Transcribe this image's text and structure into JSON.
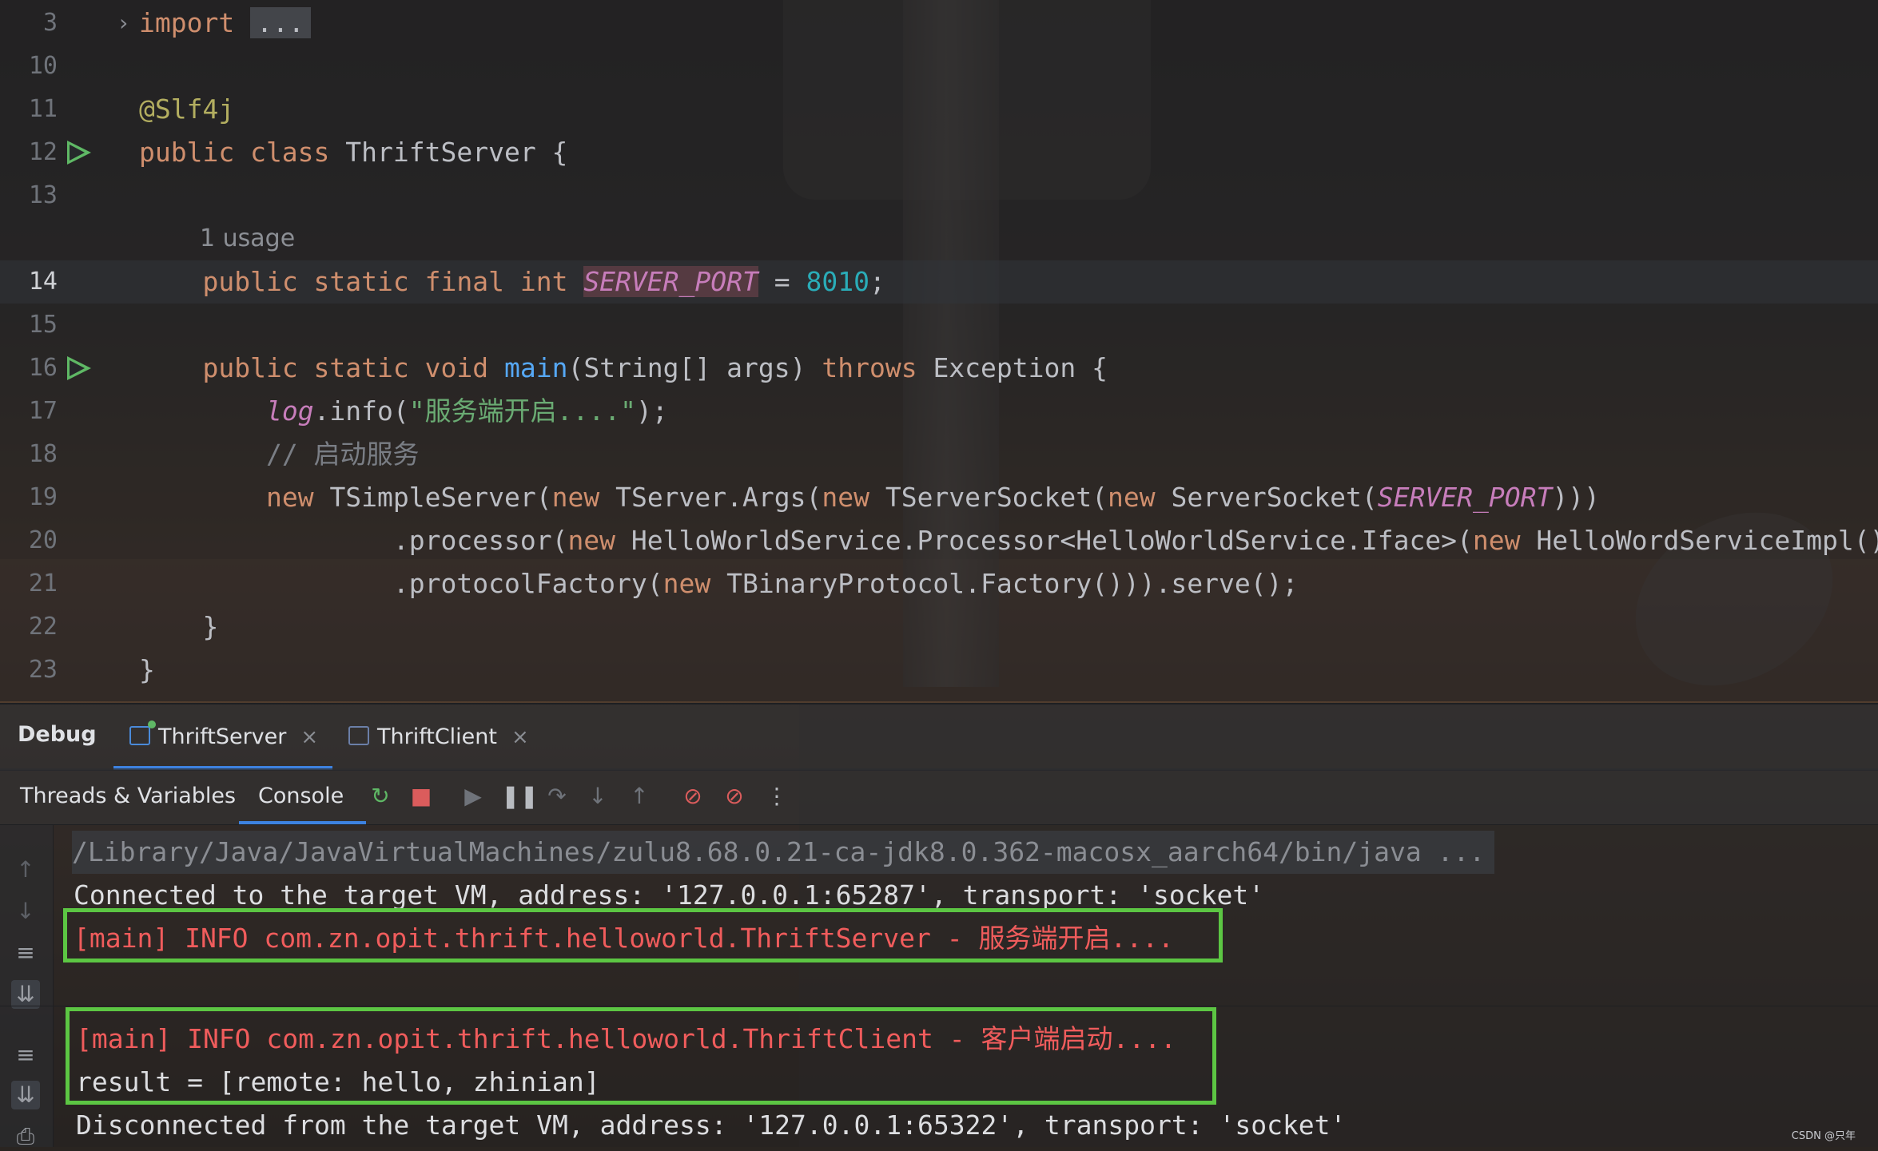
{
  "editor": {
    "lines": [
      {
        "num": "3",
        "parts": [
          [
            "kw",
            "import"
          ],
          [
            "t",
            " "
          ],
          [
            "fold",
            "..."
          ]
        ],
        "fold_marker": true
      },
      {
        "num": "10",
        "parts": []
      },
      {
        "num": "11",
        "parts": [
          [
            "ann",
            "@Slf4j"
          ]
        ]
      },
      {
        "num": "12",
        "parts": [
          [
            "kw",
            "public class "
          ],
          [
            "t",
            "ThriftServer {"
          ]
        ],
        "run": true
      },
      {
        "num": "13",
        "parts": []
      },
      {
        "num": "",
        "usage": "1 usage"
      },
      {
        "num": "14",
        "current": true,
        "parts": [
          [
            "t",
            "    "
          ],
          [
            "kw",
            "public static final int "
          ],
          [
            "sfhl",
            "SERVER_PORT"
          ],
          [
            "t",
            " = "
          ],
          [
            "num",
            "8010"
          ],
          [
            "t",
            ";"
          ]
        ]
      },
      {
        "num": "15",
        "parts": []
      },
      {
        "num": "16",
        "run": true,
        "parts": [
          [
            "t",
            "    "
          ],
          [
            "kw",
            "public static void "
          ],
          [
            "fn",
            "main"
          ],
          [
            "t",
            "(String[] args) "
          ],
          [
            "kw",
            "throws "
          ],
          [
            "t",
            "Exception {"
          ]
        ]
      },
      {
        "num": "17",
        "parts": [
          [
            "t",
            "        "
          ],
          [
            "sf",
            "log"
          ],
          [
            "t",
            ".info("
          ],
          [
            "str",
            "\"服务端开启....\""
          ],
          [
            "t",
            ");"
          ]
        ]
      },
      {
        "num": "18",
        "parts": [
          [
            "t",
            "        "
          ],
          [
            "cmt",
            "// 启动服务"
          ]
        ]
      },
      {
        "num": "19",
        "parts": [
          [
            "t",
            "        "
          ],
          [
            "kw",
            "new "
          ],
          [
            "t",
            "TSimpleServer("
          ],
          [
            "kw",
            "new "
          ],
          [
            "t",
            "TServer.Args("
          ],
          [
            "kw",
            "new "
          ],
          [
            "t",
            "TServerSocket("
          ],
          [
            "kw",
            "new "
          ],
          [
            "t",
            "ServerSocket("
          ],
          [
            "sf",
            "SERVER_PORT"
          ],
          [
            "t",
            ")))"
          ]
        ]
      },
      {
        "num": "20",
        "parts": [
          [
            "t",
            "                "
          ],
          [
            "t",
            ".processor("
          ],
          [
            "kw",
            "new "
          ],
          [
            "t",
            "HelloWorldService.Processor<HelloWorldService.Iface>("
          ],
          [
            "kw",
            "new "
          ],
          [
            "t",
            "HelloWordServiceImpl()))"
          ]
        ]
      },
      {
        "num": "21",
        "parts": [
          [
            "t",
            "                "
          ],
          [
            "t",
            ".protocolFactory("
          ],
          [
            "kw",
            "new "
          ],
          [
            "t",
            "TBinaryProtocol.Factory())).serve();"
          ]
        ]
      },
      {
        "num": "22",
        "parts": [
          [
            "t",
            "    }"
          ]
        ]
      },
      {
        "num": "23",
        "parts": [
          [
            "t",
            "}"
          ]
        ]
      }
    ]
  },
  "toolwindow": {
    "title": "Debug",
    "tabs": [
      {
        "label": "ThriftServer",
        "active": true
      },
      {
        "label": "ThriftClient",
        "active": false
      }
    ],
    "close_glyph": "×",
    "subtabs": [
      {
        "label": "Threads & Variables",
        "active": false
      },
      {
        "label": "Console",
        "active": true
      }
    ]
  },
  "console": {
    "path_line": "/Library/Java/JavaVirtualMachines/zulu8.68.0.21-ca-jdk8.0.362-macosx_aarch64/bin/java ...",
    "connected_line": "Connected to the target VM, address: '127.0.0.1:65287', transport: 'socket'",
    "server_log": "[main] INFO com.zn.opit.thrift.helloworld.ThriftServer - 服务端开启....",
    "client_log": "[main] INFO com.zn.opit.thrift.helloworld.ThriftClient - 客户端启动....",
    "result_line": "result = [remote: hello, zhinian]",
    "disconnected_line": "Disconnected from the target VM, address: '127.0.0.1:65322', transport: 'socket'"
  },
  "watermark": "CSDN @只年",
  "colors": {
    "keyword": "#cf8e6d",
    "annotation": "#b3ae60",
    "number": "#2aacb8",
    "string": "#6aab73",
    "static_field": "#c77dbb",
    "method": "#56a8f5",
    "error_text": "#f05c5c",
    "highlight_box": "#5cc643",
    "tab_underline": "#3d82e0"
  }
}
